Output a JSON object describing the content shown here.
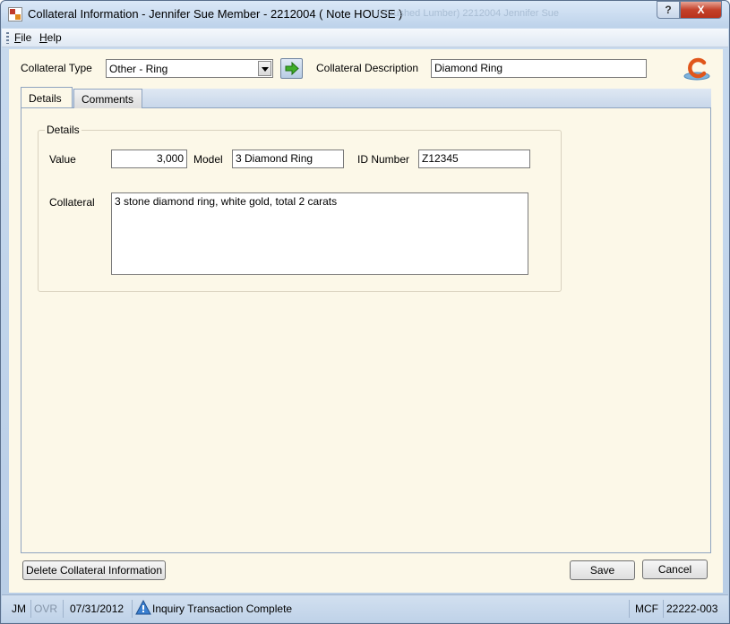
{
  "window": {
    "title": "Collateral Information - Jennifer Sue Member - 2212004 ( Note  HOUSE )",
    "ghost_title": "( Crushed Lumber)    2212004 Jennifer Sue",
    "help_glyph": "?",
    "close_glyph": "X"
  },
  "menu": {
    "file_first": "F",
    "file_rest": "ile",
    "help_first": "H",
    "help_rest": "elp"
  },
  "header": {
    "collateral_type_label": "Collateral Type",
    "collateral_type_value": "Other - Ring",
    "collateral_description_label": "Collateral Description",
    "collateral_description_value": "Diamond Ring"
  },
  "tabs": [
    {
      "label": "Details"
    },
    {
      "label": "Comments"
    }
  ],
  "details": {
    "group_title": "Details",
    "value_label": "Value",
    "value_value": "3,000",
    "model_label": "Model",
    "model_value": "3 Diamond Ring",
    "id_label": "ID Number",
    "id_value": "Z12345",
    "collateral_label": "Collateral",
    "collateral_value": "3 stone diamond ring, white gold, total 2 carats"
  },
  "buttons": {
    "delete": "Delete Collateral Information",
    "save": "Save",
    "cancel": "Cancel"
  },
  "status": {
    "user": "JM",
    "ovr": "OVR",
    "date": "07/31/2012",
    "message": "Inquiry Transaction Complete",
    "system": "MCF",
    "account": "22222-003"
  },
  "colors": {
    "client_bg": "#fcf8e8",
    "logo_orange": "#e0561b",
    "arrow_green": "#3fae2a"
  }
}
